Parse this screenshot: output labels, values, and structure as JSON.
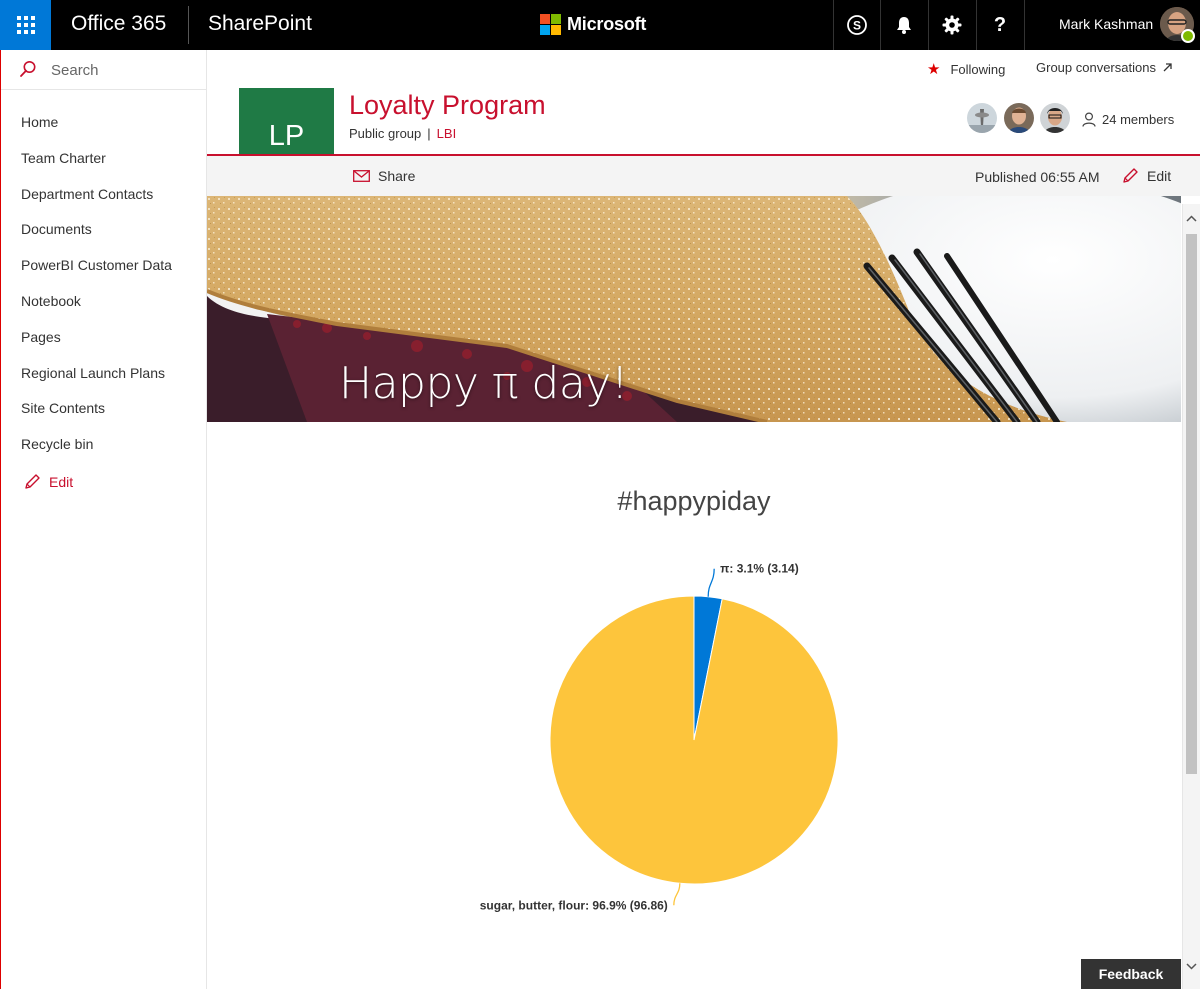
{
  "suitebar": {
    "app_launcher_icon": "waffle-icon",
    "suite_title": "Office 365",
    "app_title": "SharePoint",
    "brand": "Microsoft",
    "skype_icon": "skype-icon",
    "notifications_icon": "bell-icon",
    "settings_icon": "gear-icon",
    "help_label": "?",
    "user_name": "Mark Kashman",
    "accent_color": "#0078d7"
  },
  "leftnav": {
    "search_placeholder": "Search",
    "items": [
      {
        "label": "Home"
      },
      {
        "label": "Team Charter"
      },
      {
        "label": "Department Contacts"
      },
      {
        "label": "Documents"
      },
      {
        "label": "PowerBI Customer Data"
      },
      {
        "label": "Notebook"
      },
      {
        "label": "Pages"
      },
      {
        "label": "Regional Launch Plans"
      },
      {
        "label": "Site Contents"
      },
      {
        "label": "Recycle bin"
      }
    ],
    "edit_label": "Edit"
  },
  "header": {
    "following_label": "Following",
    "group_conversations_label": "Group conversations",
    "logo_initials": "LP",
    "logo_color": "#1f7a45",
    "title": "Loyalty Program",
    "privacy": "Public group",
    "separator": "|",
    "classification": "LBI",
    "members_count": "24 members",
    "brand_color": "#c8102e"
  },
  "commandbar": {
    "share_label": "Share",
    "published_label": "Published 06:55 AM",
    "edit_label": "Edit"
  },
  "hero": {
    "title": "Happy π day!"
  },
  "feedback_label": "Feedback",
  "chart_data": {
    "type": "pie",
    "title": "#happypiday",
    "slices": [
      {
        "name": "π",
        "value": 3.14,
        "percent": "3.1%",
        "label": "π: 3.1% (3.14)",
        "color": "#0078d7"
      },
      {
        "name": "sugar, butter, flour",
        "value": 96.86,
        "percent": "96.9%",
        "label": "sugar, butter, flour: 96.9% (96.86)",
        "color": "#fdc53c"
      }
    ]
  }
}
